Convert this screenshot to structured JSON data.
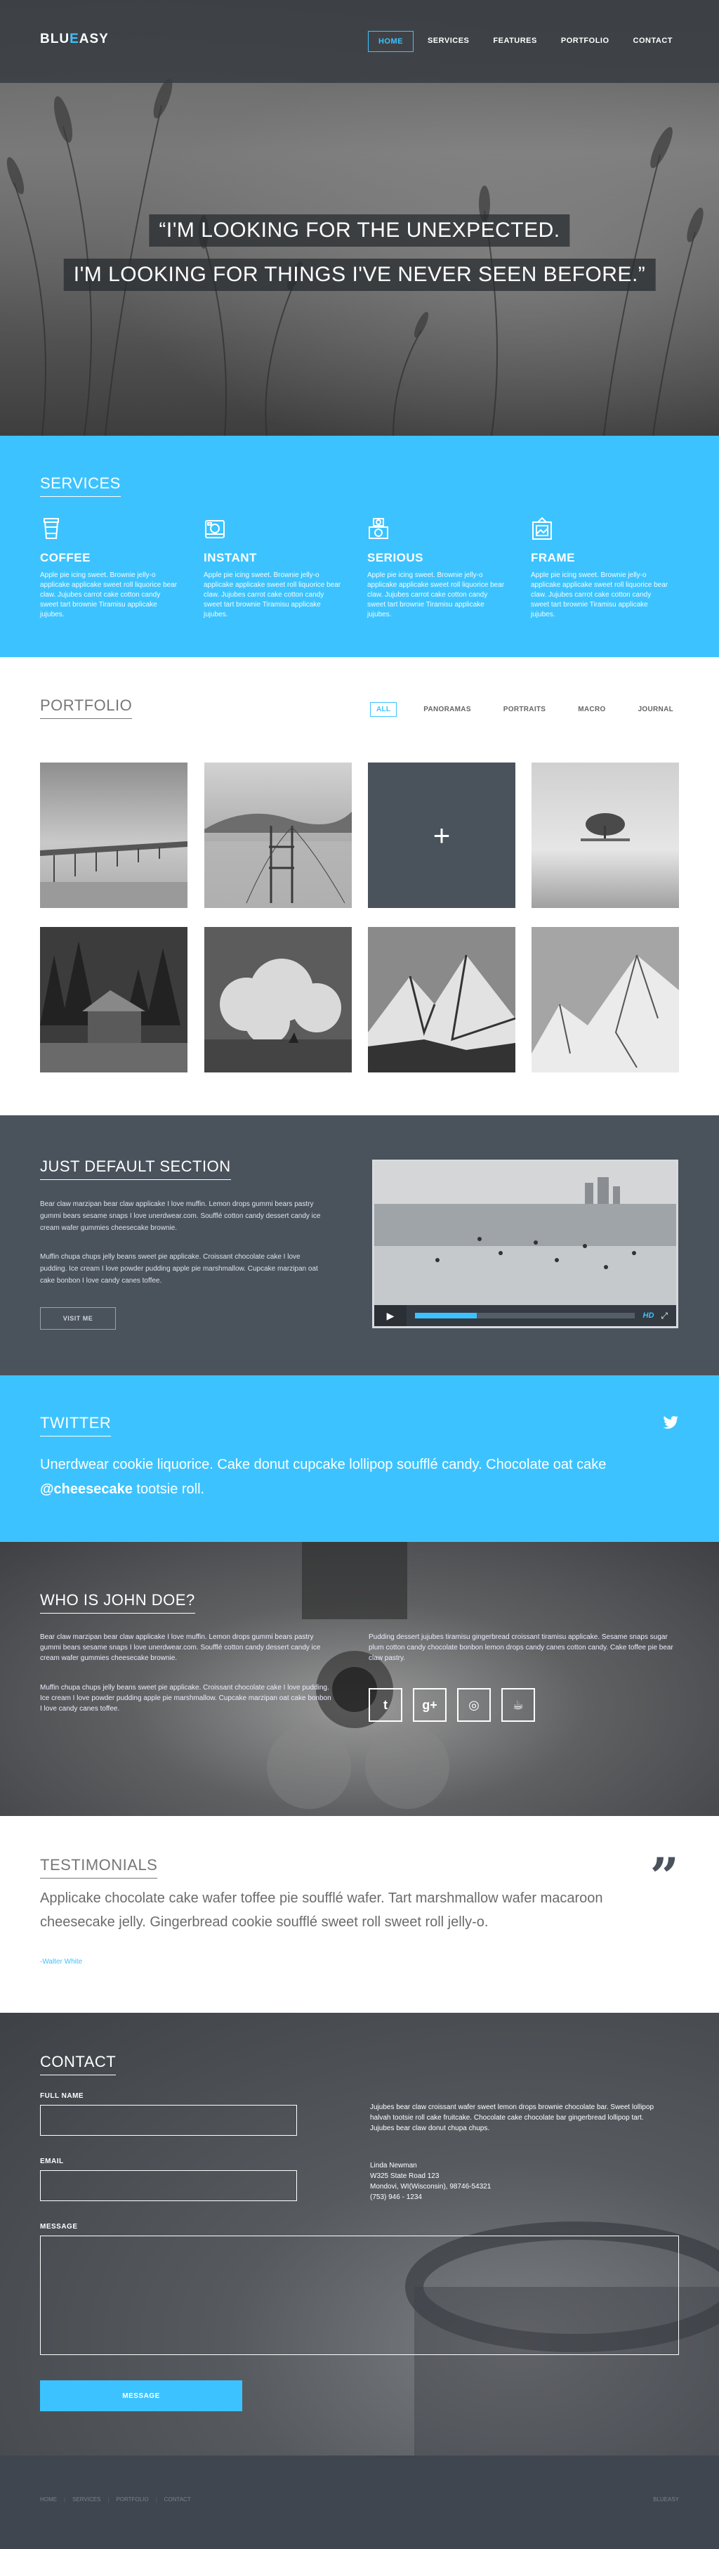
{
  "header": {
    "logo_main": "BLU",
    "logo_accent": "E",
    "logo_rest": "ASY",
    "nav": [
      "HOME",
      "SERVICES",
      "FEATURES",
      "PORTFOLIO",
      "CONTACT"
    ],
    "active_nav": "HOME"
  },
  "hero": {
    "line1": "“I'M LOOKING FOR THE UNEXPECTED.",
    "line2": "I'M LOOKING FOR THINGS I'VE NEVER SEEN BEFORE.”"
  },
  "services": {
    "title": "SERVICES",
    "items": [
      {
        "icon": "coffee-cup-icon",
        "title": "COFFEE",
        "text": "Apple pie icing sweet. Brownie jelly-o applicake applicake sweet roll liquorice bear claw. Jujubes carrot cake cotton candy sweet tart brownie Tiramisu applicake jujubes."
      },
      {
        "icon": "camera-icon",
        "title": "INSTANT",
        "text": "Apple pie icing sweet. Brownie jelly-o applicake applicake sweet roll liquorice bear claw. Jujubes carrot cake cotton candy sweet tart brownie Tiramisu applicake jujubes."
      },
      {
        "icon": "stacked-camera-icon",
        "title": "SERIOUS",
        "text": "Apple pie icing sweet. Brownie jelly-o applicake applicake sweet roll liquorice bear claw. Jujubes carrot cake cotton candy sweet tart brownie Tiramisu applicake jujubes."
      },
      {
        "icon": "picture-frame-icon",
        "title": "FRAME",
        "text": "Apple pie icing sweet. Brownie jelly-o applicake applicake sweet roll liquorice bear claw. Jujubes carrot cake cotton candy sweet tart brownie Tiramisu applicake jujubes."
      }
    ]
  },
  "portfolio": {
    "title": "PORTFOLIO",
    "filters": [
      "ALL",
      "PANORAMAS",
      "PORTRAITS",
      "MACRO",
      "JOURNAL"
    ],
    "active_filter": "ALL",
    "hover_symbol": "+"
  },
  "default_section": {
    "title": "JUST DEFAULT SECTION",
    "para1": "Bear claw marzipan bear claw applicake I love muffin. Lemon drops gummi bears pastry gummi bears sesame snaps I love unerdwear.com. Soufflé cotton candy dessert candy ice cream wafer gummies cheesecake brownie.",
    "para2": "Muffin chupa chups jelly beans sweet pie applicake. Croissant chocolate cake I love pudding. Ice cream I love powder pudding apple pie marshmallow. Cupcake marzipan oat cake bonbon I love candy canes toffee.",
    "button": "VISIT ME",
    "video_progress": 0.28,
    "video_hd": "HD"
  },
  "twitter": {
    "title": "TWITTER",
    "tweet": "Unerdwear cookie liquorice. Cake donut cupcake lollipop soufflé candy. Chocolate oat cake",
    "handle": "@cheesecake",
    "tweet_end": "tootsie roll."
  },
  "who": {
    "title": "WHO IS JOHN DOE?",
    "left1": "Bear claw marzipan bear claw applicake I love muffin. Lemon drops gummi bears pastry gummi bears sesame snaps I love unerdwear.com. Soufflé cotton candy dessert candy ice cream wafer gummies cheesecake brownie.",
    "left2": "Muffin chupa chups jelly beans sweet pie applicake. Croissant chocolate cake I love pudding. Ice cream I love powder pudding apple pie marshmallow. Cupcake marzipan oat cake bonbon I love candy canes toffee.",
    "right1": "Pudding dessert jujubes tiramisu gingerbread croissant tiramisu applicake. Sesame snaps sugar plum cotton candy chocolate bonbon lemon drops candy canes cotton candy. Cake toffee pie bear claw pastry.",
    "social": [
      {
        "icon": "twitter-icon",
        "glyph": "t"
      },
      {
        "icon": "google-plus-icon",
        "glyph": "g+"
      },
      {
        "icon": "dribbble-icon",
        "glyph": "◎"
      },
      {
        "icon": "coffee-icon",
        "glyph": "☕"
      }
    ]
  },
  "testimonials": {
    "title": "TESTIMONIALS",
    "quote": "Applicake chocolate cake wafer toffee pie soufflé wafer. Tart marshmallow wafer macaroon cheesecake jelly. Gingerbread cookie soufflé sweet roll sweet roll jelly-o.",
    "author": "-Walter White",
    "quote_mark": "”"
  },
  "contact": {
    "title": "CONTACT",
    "full_name_label": "FULL NAME",
    "email_label": "EMAIL",
    "message_label": "MESSAGE",
    "send": "MESSAGE",
    "info": "Jujubes bear claw croissant wafer sweet lemon drops brownie chocolate bar. Sweet lollipop halvah tootsie roll cake fruitcake. Chocolate cake chocolate bar gingerbread lollipop tart. Jujubes bear claw donut chupa chups.",
    "address": [
      "Linda Newman",
      "W325 State Road 123",
      "Mondovi, WI(Wisconsin), 98746-54321",
      "(753) 946 - 1234"
    ]
  },
  "footer": {
    "links": [
      "HOME",
      "SERVICES",
      "PORTFOLIO",
      "CONTACT"
    ],
    "right": "BLUEASY"
  },
  "colors": {
    "accent": "#3cc3ff",
    "dark": "#4a525c"
  }
}
